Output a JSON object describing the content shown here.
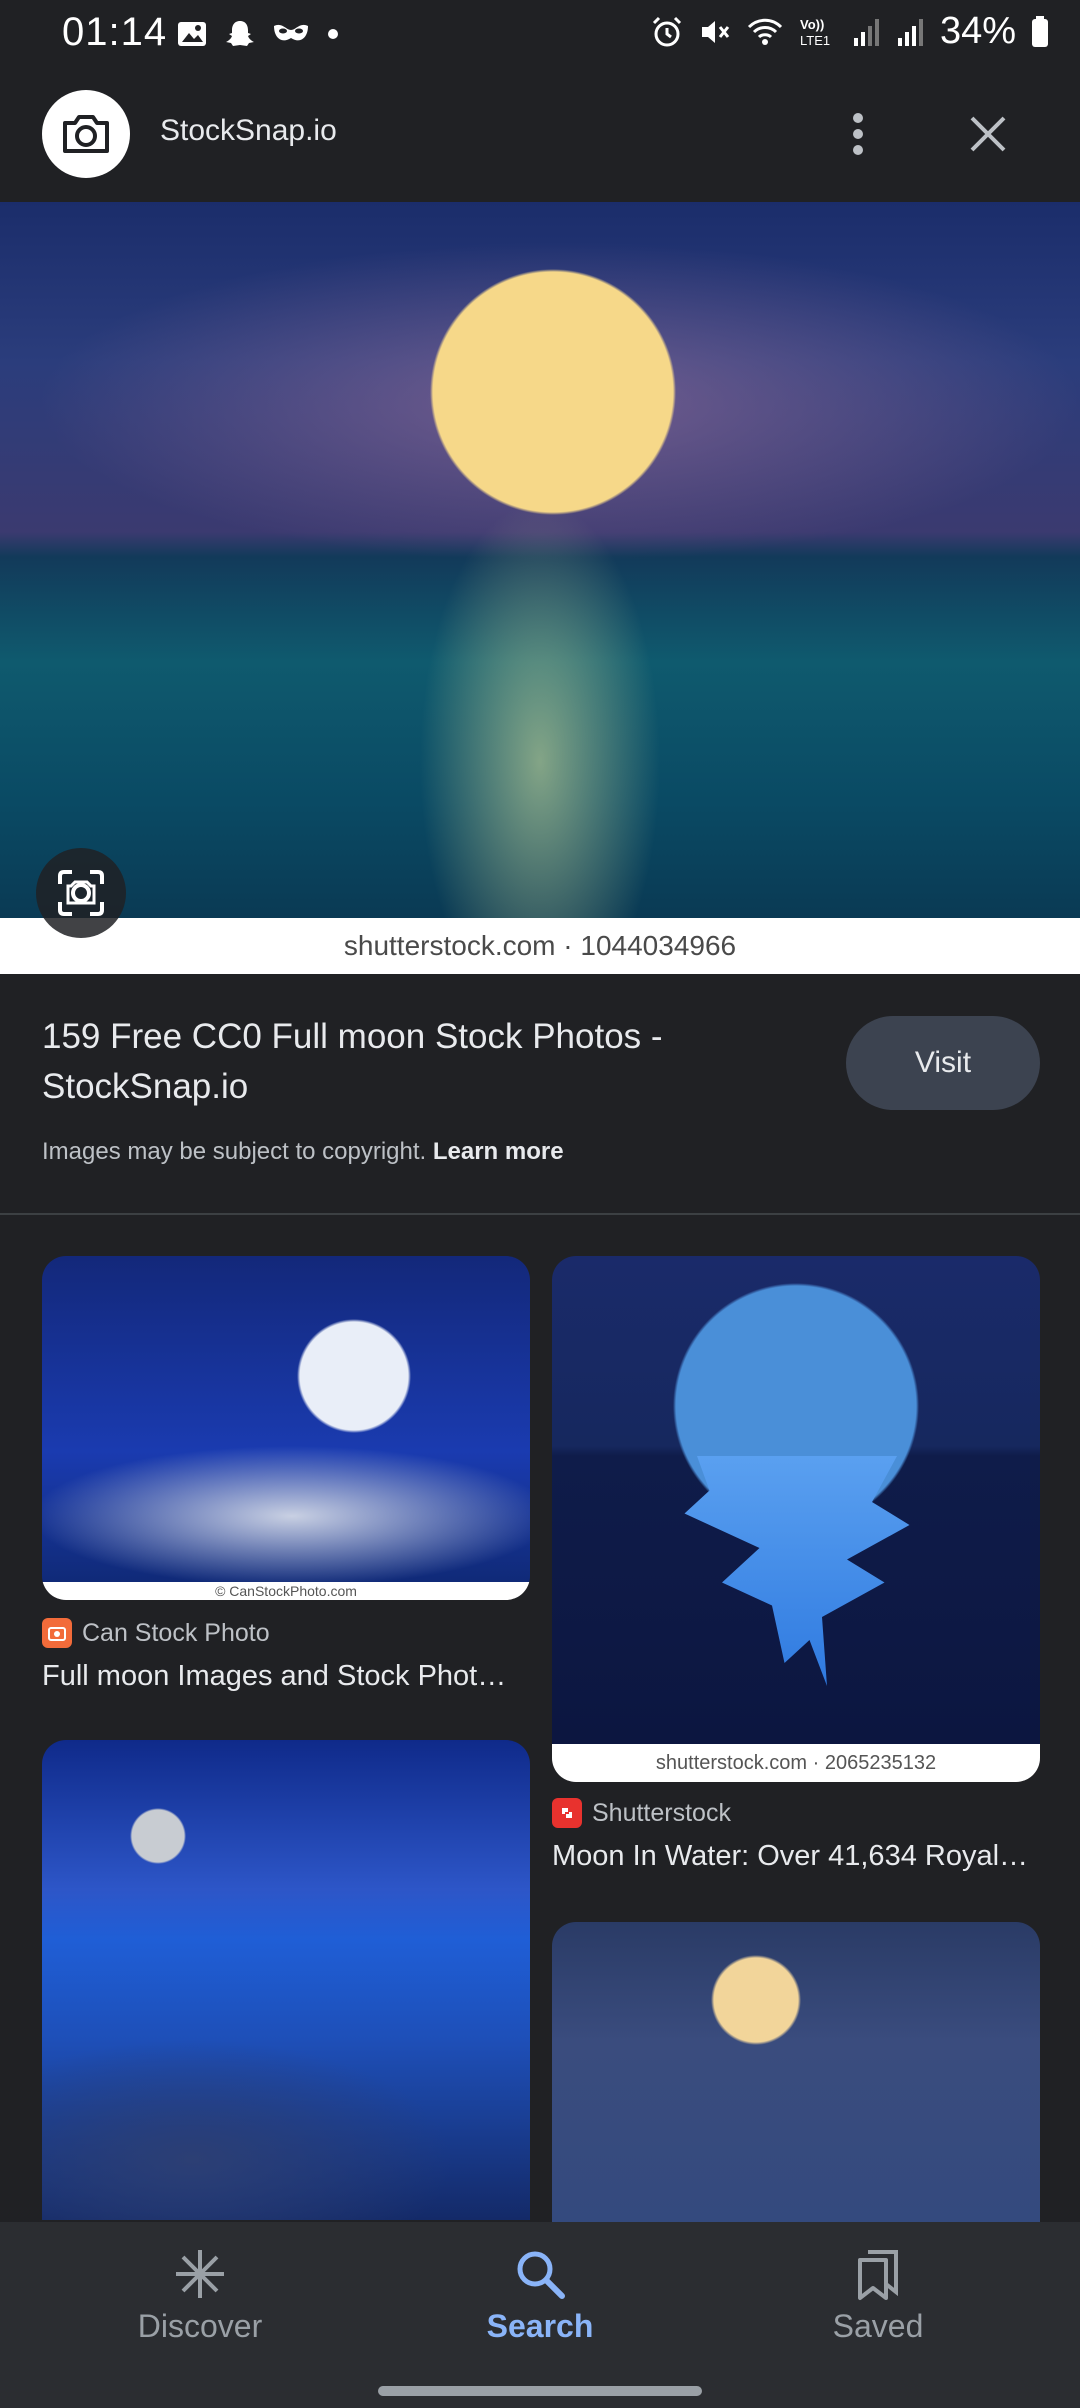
{
  "status_bar": {
    "time": "01:14",
    "battery": "34%",
    "icons": [
      "gallery-icon",
      "snapchat-icon",
      "mask-icon",
      "dot-icon",
      "alarm-icon",
      "mute-icon",
      "wifi-icon",
      "volte-icon",
      "signal-icon",
      "signal-icon",
      "battery-icon"
    ]
  },
  "header": {
    "site_name": "StockSnap.io",
    "logo_icon": "camera-icon"
  },
  "hero": {
    "watermark": "shutterstock.com · 1044034966"
  },
  "result": {
    "title": "159 Free CC0 Full moon Stock Photos - StockSnap.io",
    "visit_label": "Visit",
    "copyright_text": "Images may be subject to copyright.",
    "learn_more": "Learn more"
  },
  "grid": [
    {
      "source": "Can Stock Photo",
      "title": "Full moon Images and Stock Phot…",
      "watermark": "© CanStockPhoto.com"
    },
    {
      "source": "Shutterstock",
      "title": "Moon In Water: Over 41,634 Royal…",
      "watermark": "shutterstock.com · 2065235132"
    }
  ],
  "nav": {
    "discover": "Discover",
    "search": "Search",
    "saved": "Saved",
    "active": "search"
  },
  "colors": {
    "background": "#202124",
    "accent": "#8ab4f8",
    "visit_button": "#3c4350"
  }
}
